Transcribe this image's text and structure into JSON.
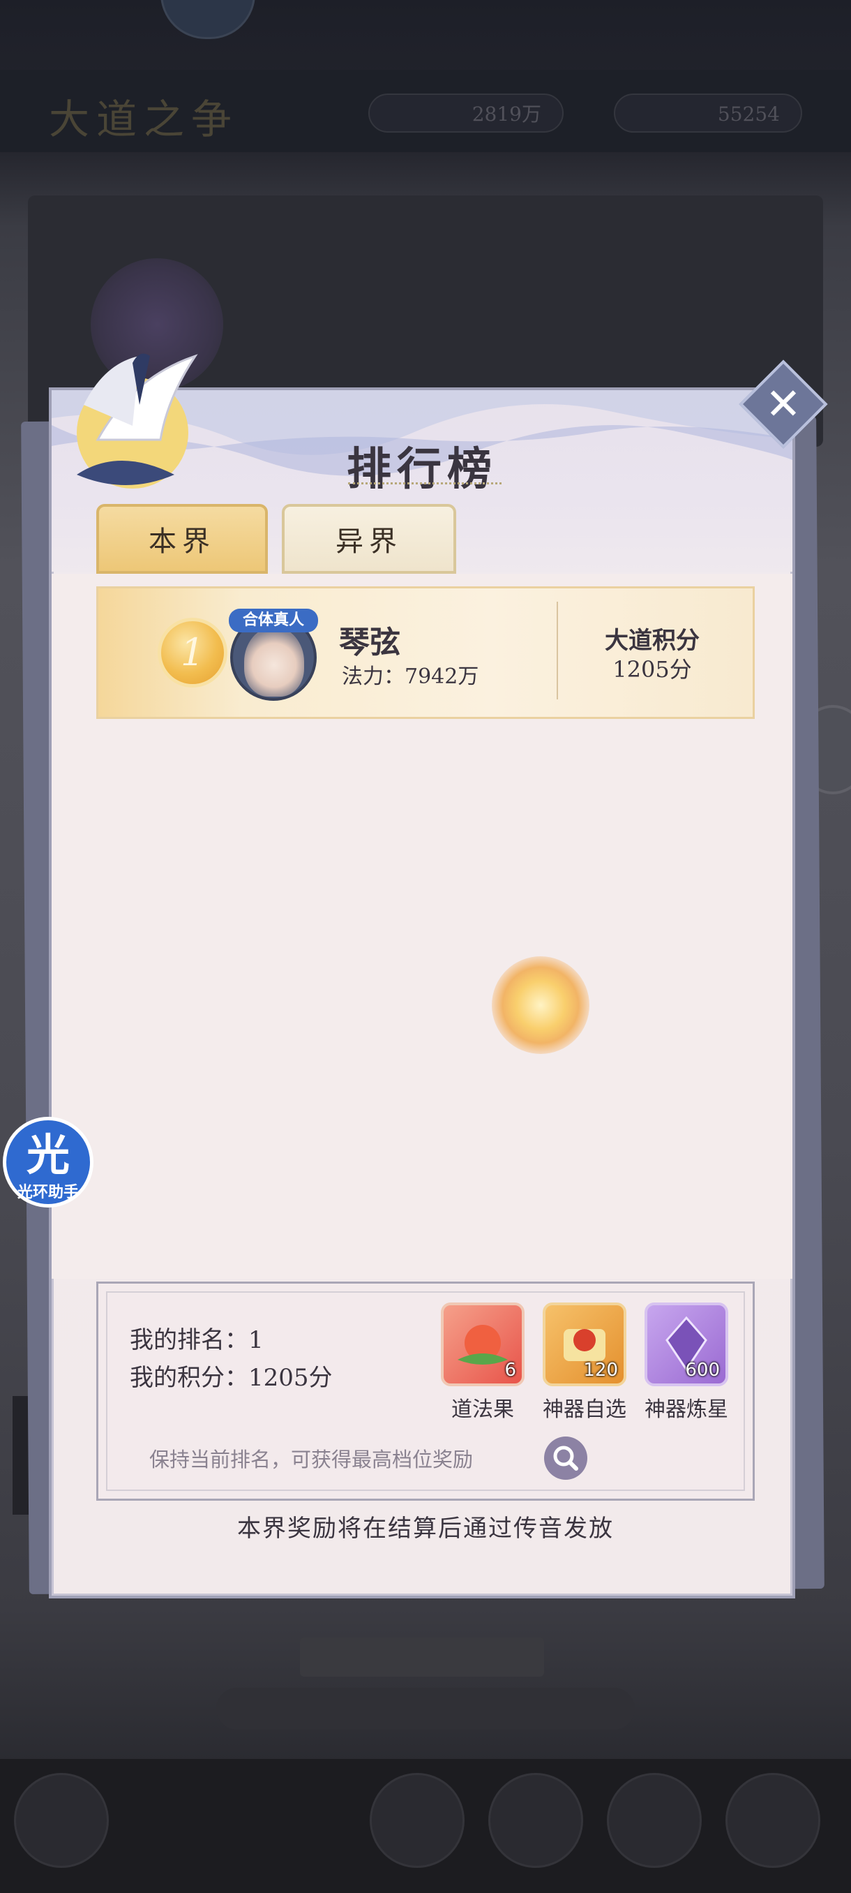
{
  "background": {
    "title": "大道之争",
    "pill_left": "2819万",
    "pill_right": "55254"
  },
  "dialog": {
    "title": "排行榜",
    "close_icon": "close-icon",
    "tabs": [
      {
        "label": "本界",
        "active": true
      },
      {
        "label": "异界",
        "active": false
      }
    ]
  },
  "leaderboard": [
    {
      "rank": "1",
      "avatar_tag": "合体真人",
      "name": "琴弦",
      "power": "法力：7942万",
      "score_label": "大道积分",
      "score_value": "1205分"
    }
  ],
  "my_info": {
    "rank": "我的排名：1",
    "score": "我的积分：1205分"
  },
  "rewards": [
    {
      "label": "道法果",
      "count": "6",
      "icon": "peach-fruit-icon",
      "color": "#e8544a"
    },
    {
      "label": "神器自选",
      "count": "120",
      "icon": "artifact-chest-icon",
      "color": "#e4902e"
    },
    {
      "label": "神器炼星",
      "count": "600",
      "icon": "purple-crystal-icon",
      "color": "#9a6ad2"
    }
  ],
  "hint": "保持当前排名，可获得最高档位奖励",
  "footer_note": "本界奖励将在结算后通过传音发放",
  "assistant": {
    "char": "光",
    "label": "光环助手"
  },
  "colors": {
    "tab_active": "#edc777",
    "dialog_border": "#9fa0b6",
    "assistant_blue": "#2f6ad0"
  }
}
